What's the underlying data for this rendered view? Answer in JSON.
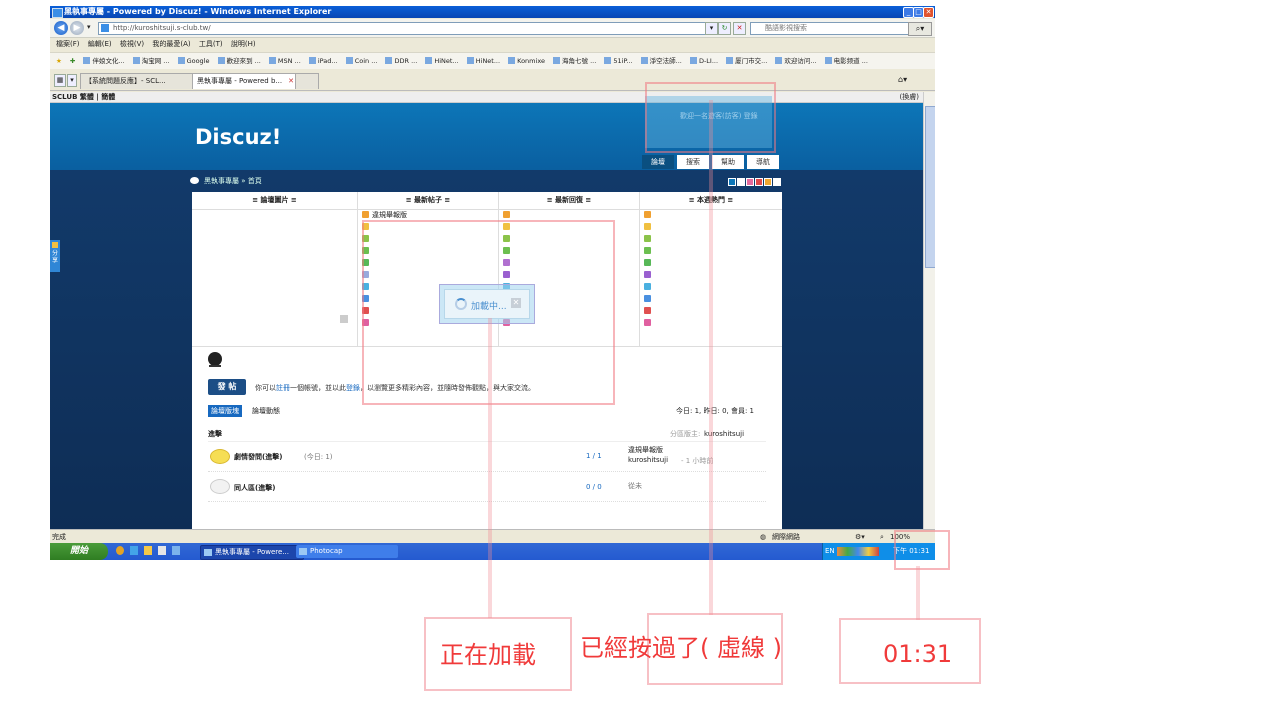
{
  "window": {
    "title": "黑執事專屬 - Powered by Discuz! - Windows Internet Explorer",
    "url": "http://kuroshitsuji.s-club.tw/",
    "search_placeholder": "酷語影視搜索",
    "menu": [
      "檔案(F)",
      "編輯(E)",
      "檢視(V)",
      "我的最愛(A)",
      "工具(T)",
      "說明(H)"
    ],
    "favorites": [
      "伴娘文化...",
      "淘宝网 ...",
      "Google",
      "歡迎來到 ...",
      "MSN ...",
      "iPad...",
      "Coin ...",
      "DDR ...",
      "HiNet...",
      "HiNet...",
      "Konmixe",
      "海角七號 ...",
      "51iP...",
      "淨空法師...",
      "D-LI...",
      "厦门市交...",
      "欢迎访问...",
      "电影频道 ..."
    ],
    "tabs": [
      {
        "label": "【系統問題反應】- SCL..."
      },
      {
        "label": "黑執事專屬 - Powered b..."
      }
    ],
    "status_text": "完成",
    "status_zone": "網際網路",
    "zoom": "100%"
  },
  "site": {
    "topbar": "SCLUB 繁體 | 簡體",
    "topbar_right": "(換膚)",
    "logo": "Discuz!",
    "userinfo": "歡迎一名遊客(訪客)  登錄",
    "nav": [
      "論壇",
      "搜索",
      "幫助",
      "導航"
    ],
    "breadcrumb": "黑執事專屬 » 首頁",
    "share_label": "分享",
    "portal": {
      "columns": [
        {
          "title": "≡ 論壇圖片 ≡",
          "rows": []
        },
        {
          "title": "≡ 最新帖子 ≡",
          "rows": [
            "違規舉報版"
          ]
        },
        {
          "title": "≡ 最新回復 ≡",
          "rows": []
        },
        {
          "title": "≡ 本週熱門 ≡",
          "rows": []
        }
      ]
    },
    "post_button": "發 帖",
    "post_message_prefix": "你可以",
    "post_message_link1": "註冊",
    "post_message_mid": "一個帳號，並以此",
    "post_message_link2": "登錄",
    "post_message_suffix": "，以瀏覽更多精彩內容，並隨時發佈觀點，與大家交流。",
    "tab_forum": "論壇版塊",
    "tab_activity": "論壇動態",
    "stats": "今日: 1, 昨日: 0, 會員: 1",
    "category": "進擊",
    "category_mod_label": "分區版主:",
    "category_mod": "kuroshitsuji",
    "forums": [
      {
        "name": "劇情發問(進擊)",
        "today": "(今日: 1)",
        "count": "1 / 1",
        "last_title": "違規舉報版",
        "last_user": "kuroshitsuji",
        "last_time": "- 1 小時前"
      },
      {
        "name": "同人區(進擊)",
        "today": "",
        "count": "0 / 0",
        "last_title": "從未",
        "last_user": "",
        "last_time": ""
      }
    ],
    "loading_text": "加載中..."
  },
  "taskbar": {
    "start": "開始",
    "tasks": [
      "黑執事專屬 - Powere...",
      "Photocap"
    ],
    "tray_lang": "EN",
    "tray_time": "下午 01:31"
  },
  "annotations": {
    "loading_note": "正在加載",
    "clicked_note": "已經按過了( 虛線 )",
    "time_note": "01:31"
  },
  "colors": {
    "header_blue": "#0d76b8",
    "body_navy": "#123a6a",
    "annotation_red": "#f03a3a"
  }
}
